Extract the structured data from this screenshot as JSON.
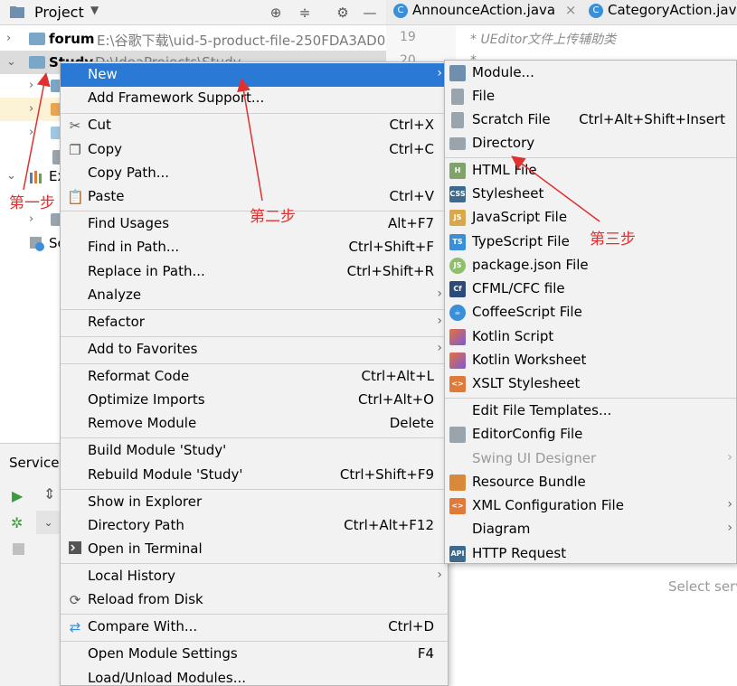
{
  "project_panel": {
    "title": "Project",
    "tree": [
      {
        "label": "forum",
        "path": "E:\\谷歌下载\\uid-5-product-file-250FDA3AD0"
      },
      {
        "label": "Study",
        "path": "D:\\IdeaProjects\\Study"
      },
      {
        "label": "Ex"
      },
      {
        "label": "Sc"
      }
    ]
  },
  "services": {
    "title": "Services"
  },
  "editor": {
    "tabs": [
      {
        "label": "AnnounceAction.java",
        "close": "×"
      },
      {
        "label": "CategoryAction.jav"
      }
    ],
    "line_numbers": [
      "19",
      "20"
    ],
    "code_line": "* UEditor文件上传辅助类",
    "code_line2": "*",
    "placeholder": "Select serv"
  },
  "context_menu": {
    "items": [
      {
        "label": "New",
        "shortcut": "",
        "submenu": true
      },
      {
        "label": "Add Framework Support...",
        "shortcut": ""
      },
      {
        "label": "Cut",
        "shortcut": "Ctrl+X",
        "icon": "scissors-icon"
      },
      {
        "label": "Copy",
        "shortcut": "Ctrl+C",
        "icon": "copy-icon"
      },
      {
        "label": "Copy Path...",
        "shortcut": ""
      },
      {
        "label": "Paste",
        "shortcut": "Ctrl+V",
        "icon": "paste-icon"
      },
      {
        "label": "Find Usages",
        "shortcut": "Alt+F7"
      },
      {
        "label": "Find in Path...",
        "shortcut": "Ctrl+Shift+F"
      },
      {
        "label": "Replace in Path...",
        "shortcut": "Ctrl+Shift+R"
      },
      {
        "label": "Analyze",
        "shortcut": "",
        "submenu": true
      },
      {
        "label": "Refactor",
        "shortcut": "",
        "submenu": true
      },
      {
        "label": "Add to Favorites",
        "shortcut": "",
        "submenu": true
      },
      {
        "label": "Reformat Code",
        "shortcut": "Ctrl+Alt+L"
      },
      {
        "label": "Optimize Imports",
        "shortcut": "Ctrl+Alt+O"
      },
      {
        "label": "Remove Module",
        "shortcut": "Delete"
      },
      {
        "label": "Build Module 'Study'",
        "shortcut": ""
      },
      {
        "label": "Rebuild Module 'Study'",
        "shortcut": "Ctrl+Shift+F9"
      },
      {
        "label": "Show in Explorer",
        "shortcut": ""
      },
      {
        "label": "Directory Path",
        "shortcut": "Ctrl+Alt+F12"
      },
      {
        "label": "Open in Terminal",
        "shortcut": "",
        "icon": "terminal-icon"
      },
      {
        "label": "Local History",
        "shortcut": "",
        "submenu": true
      },
      {
        "label": "Reload from Disk",
        "shortcut": "",
        "icon": "reload-icon"
      },
      {
        "label": "Compare With...",
        "shortcut": "Ctrl+D",
        "icon": "compare-icon"
      },
      {
        "label": "Open Module Settings",
        "shortcut": "F4"
      },
      {
        "label": "Load/Unload Modules...",
        "shortcut": ""
      }
    ]
  },
  "new_submenu": {
    "items": [
      {
        "label": "Module...",
        "icon": "module-icon"
      },
      {
        "label": "File",
        "icon": "file-icon"
      },
      {
        "label": "Scratch File",
        "shortcut": "Ctrl+Alt+Shift+Insert",
        "icon": "scratch-file-icon"
      },
      {
        "label": "Directory",
        "icon": "folder-icon"
      },
      {
        "label": "HTML File",
        "icon": "html-file-icon"
      },
      {
        "label": "Stylesheet",
        "icon": "css-file-icon"
      },
      {
        "label": "JavaScript File",
        "icon": "js-file-icon"
      },
      {
        "label": "TypeScript File",
        "icon": "ts-file-icon"
      },
      {
        "label": "package.json File",
        "icon": "nodejs-icon"
      },
      {
        "label": "CFML/CFC file",
        "icon": "cfml-icon"
      },
      {
        "label": "CoffeeScript File",
        "icon": "coffeescript-icon"
      },
      {
        "label": "Kotlin Script",
        "icon": "kotlin-icon"
      },
      {
        "label": "Kotlin Worksheet",
        "icon": "kotlin-icon"
      },
      {
        "label": "XSLT Stylesheet",
        "icon": "xslt-icon"
      },
      {
        "label": "Edit File Templates...",
        "icon": ""
      },
      {
        "label": "EditorConfig File",
        "icon": "editorconfig-icon"
      },
      {
        "label": "Swing UI Designer",
        "icon": "",
        "disabled": true,
        "submenu": true
      },
      {
        "label": "Resource Bundle",
        "icon": "resource-bundle-icon"
      },
      {
        "label": "XML Configuration File",
        "icon": "xml-file-icon",
        "submenu": true
      },
      {
        "label": "Diagram",
        "icon": "",
        "submenu": true
      },
      {
        "label": "HTTP Request",
        "icon": "api-icon"
      }
    ]
  },
  "annotations": {
    "step1": "第一步",
    "step2": "第二步",
    "step3": "第三步"
  },
  "colors": {
    "selection": "#2a7ad5",
    "annotation": "#e03030"
  }
}
